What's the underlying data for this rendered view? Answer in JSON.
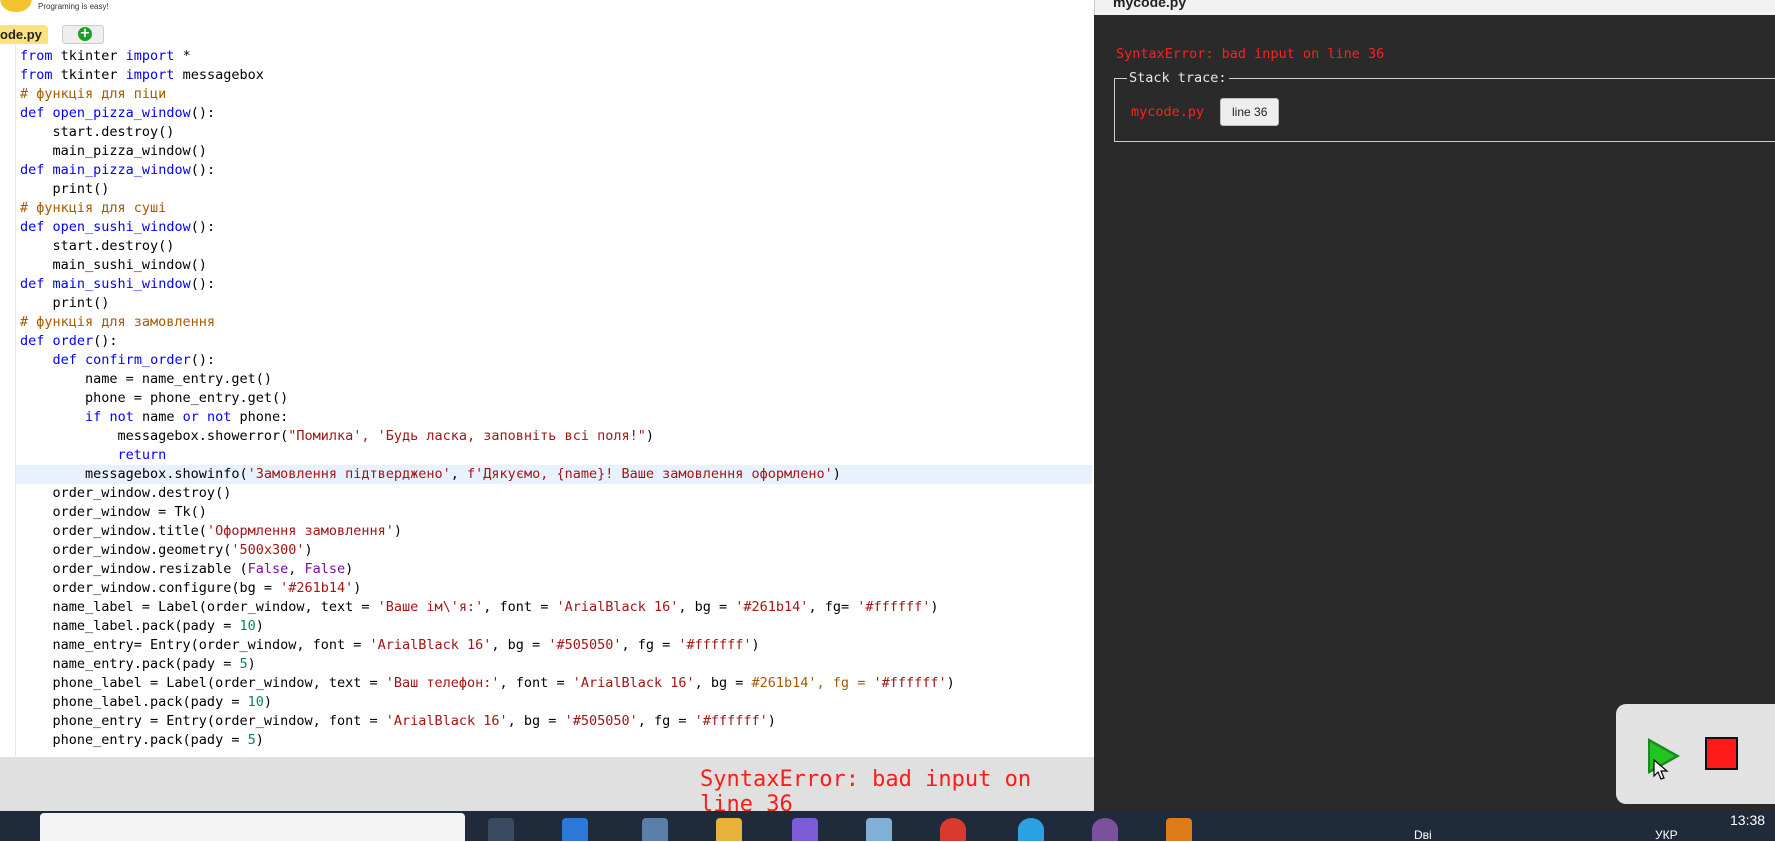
{
  "app": {
    "logo_tagline": "Programing is easy!",
    "tabs": [
      {
        "label": "ode.py"
      }
    ],
    "add_tab_glyph": "+"
  },
  "editor": {
    "lines": [
      [
        [
          "from",
          "kw"
        ],
        [
          " tkinter ",
          ""
        ],
        [
          "import",
          "kw"
        ],
        [
          " *",
          ""
        ]
      ],
      [
        [
          "from",
          "kw"
        ],
        [
          " tkinter ",
          ""
        ],
        [
          "import",
          "kw"
        ],
        [
          " messagebox",
          ""
        ]
      ],
      [
        [
          "# функція для піци",
          "cm"
        ]
      ],
      [
        [
          "def",
          "kw"
        ],
        [
          " ",
          ""
        ],
        [
          "open_pizza_window",
          "fn"
        ],
        [
          "():",
          ""
        ]
      ],
      [
        [
          "    start.destroy()",
          ""
        ]
      ],
      [
        [
          "    main_pizza_window()",
          ""
        ]
      ],
      [
        [
          "def",
          "kw"
        ],
        [
          " ",
          ""
        ],
        [
          "main_pizza_window",
          "fn"
        ],
        [
          "():",
          ""
        ]
      ],
      [
        [
          "    print()",
          ""
        ]
      ],
      [
        [
          "# функція для суші",
          "cm"
        ]
      ],
      [
        [
          "def",
          "kw"
        ],
        [
          " ",
          ""
        ],
        [
          "open_sushi_window",
          "fn"
        ],
        [
          "():",
          ""
        ]
      ],
      [
        [
          "    start.destroy()",
          ""
        ]
      ],
      [
        [
          "    main_sushi_window()",
          ""
        ]
      ],
      [
        [
          "def",
          "kw"
        ],
        [
          " ",
          ""
        ],
        [
          "main_sushi_window",
          "fn"
        ],
        [
          "():",
          ""
        ]
      ],
      [
        [
          "    print()",
          ""
        ]
      ],
      [
        [
          "# функція для замовлення",
          "cm"
        ]
      ],
      [
        [
          "def",
          "kw"
        ],
        [
          " ",
          ""
        ],
        [
          "order",
          "fn"
        ],
        [
          "():",
          ""
        ]
      ],
      [
        [
          "    ",
          ""
        ],
        [
          "def",
          "kw"
        ],
        [
          " ",
          ""
        ],
        [
          "confirm_order",
          "fn"
        ],
        [
          "():",
          ""
        ]
      ],
      [
        [
          "        name = name_entry.get()",
          ""
        ]
      ],
      [
        [
          "        phone = phone_entry.get()",
          ""
        ]
      ],
      [
        [
          "        ",
          ""
        ],
        [
          "if",
          "kw"
        ],
        [
          " ",
          ""
        ],
        [
          "not",
          "kw"
        ],
        [
          " name ",
          ""
        ],
        [
          "or",
          "kw"
        ],
        [
          " ",
          ""
        ],
        [
          "not",
          "kw"
        ],
        [
          " phone:",
          ""
        ]
      ],
      [
        [
          "            messagebox.showerror(",
          ""
        ],
        [
          "\"Помилка', 'Будь ласка, заповніть всі поля!\"",
          "st"
        ],
        [
          ")",
          ""
        ]
      ],
      [
        [
          "            ",
          ""
        ],
        [
          "return",
          "kw"
        ]
      ],
      [
        [
          "        messagebox.showinfo(",
          ""
        ],
        [
          "'Замовлення підтверджено'",
          "st"
        ],
        [
          ", ",
          ""
        ],
        [
          "f'Дякуємо, {name}! Ваше замовлення оформлено'",
          "st"
        ],
        [
          ")",
          ""
        ]
      ],
      [
        [
          "    order_window.destroy()",
          ""
        ]
      ],
      [
        [
          "    order_window = Tk()",
          ""
        ]
      ],
      [
        [
          "    order_window.title(",
          ""
        ],
        [
          "'Оформлення замовлення'",
          "st"
        ],
        [
          ")",
          ""
        ]
      ],
      [
        [
          "    order_window.geometry(",
          ""
        ],
        [
          "'500x300'",
          "st"
        ],
        [
          ")",
          ""
        ]
      ],
      [
        [
          "    order_window.resizable (",
          ""
        ],
        [
          "False",
          "bi"
        ],
        [
          ", ",
          ""
        ],
        [
          "False",
          "bi"
        ],
        [
          ")",
          ""
        ]
      ],
      [
        [
          "    order_window.configure(bg = ",
          ""
        ],
        [
          "'#261b14'",
          "st"
        ],
        [
          ")",
          ""
        ]
      ],
      [
        [
          "    name_label = Label(order_window, text = ",
          ""
        ],
        [
          "'Ваше ім\\'я:'",
          "st"
        ],
        [
          ", font = ",
          ""
        ],
        [
          "'ArialBlack 16'",
          "st"
        ],
        [
          ", bg = ",
          ""
        ],
        [
          "'#261b14'",
          "st"
        ],
        [
          ", fg= ",
          ""
        ],
        [
          "'#ffffff'",
          "st"
        ],
        [
          ")",
          ""
        ]
      ],
      [
        [
          "    name_label.pack(pady = ",
          ""
        ],
        [
          "10",
          "nm"
        ],
        [
          ")",
          ""
        ]
      ],
      [
        [
          "    name_entry= Entry(order_window, font = ",
          ""
        ],
        [
          "'ArialBlack 16'",
          "st"
        ],
        [
          ", bg = ",
          ""
        ],
        [
          "'#505050'",
          "st"
        ],
        [
          ", fg = ",
          ""
        ],
        [
          "'#ffffff'",
          "st"
        ],
        [
          ")",
          ""
        ]
      ],
      [
        [
          "    name_entry.pack(pady = ",
          ""
        ],
        [
          "5",
          "nm"
        ],
        [
          ")",
          ""
        ]
      ],
      [
        [
          "    phone_label = Label(order_window, text = ",
          ""
        ],
        [
          "'Ваш телефон:'",
          "st"
        ],
        [
          ", font = ",
          ""
        ],
        [
          "'ArialBlack 16'",
          "st"
        ],
        [
          ", bg = ",
          ""
        ],
        [
          "#261b14', fg = ",
          "cm"
        ],
        [
          "'#ffffff'",
          "st"
        ],
        [
          ")",
          ""
        ]
      ],
      [
        [
          "    phone_label.pack(pady = ",
          ""
        ],
        [
          "10",
          "nm"
        ],
        [
          ")",
          ""
        ]
      ],
      [
        [
          "    phone_entry = Entry(order_window, font = ",
          ""
        ],
        [
          "'ArialBlack 16'",
          "st"
        ],
        [
          ", bg = ",
          ""
        ],
        [
          "'#505050'",
          "st"
        ],
        [
          ", fg = ",
          ""
        ],
        [
          "'#ffffff'",
          "st"
        ],
        [
          ")",
          ""
        ]
      ],
      [
        [
          "    phone_entry.pack(pady = ",
          ""
        ],
        [
          "5",
          "nm"
        ],
        [
          ")",
          ""
        ]
      ]
    ],
    "active_line_index": 22
  },
  "output": {
    "title": "mycode.py",
    "error_message": "SyntaxError: bad input on line 36",
    "stack_trace_label": "Stack trace:",
    "trace_file": "mycode.py",
    "trace_line_button": "line 36"
  },
  "bottom_bar": {
    "error_message": "SyntaxError: bad input on line 36"
  },
  "controls": {
    "run_icon": "play-icon",
    "stop_icon": "stop-icon"
  },
  "taskbar": {
    "weather_text": "Dві",
    "language": "УКР",
    "clock": "13:38"
  },
  "colors": {
    "keyword": "#0000ff",
    "comment": "#a55a00",
    "string": "#a31515",
    "number": "#098658",
    "builtin": "#7a0f9a",
    "error": "#ff2020",
    "output_bg": "#2a2a2a"
  }
}
